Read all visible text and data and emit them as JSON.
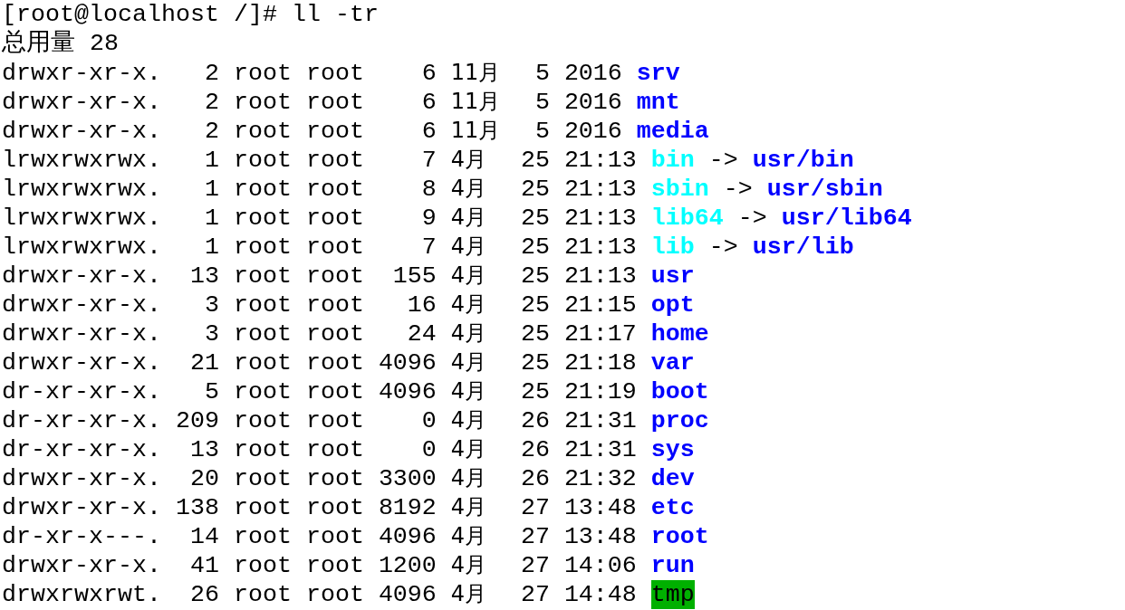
{
  "prompt": "[root@localhost /]# ll -tr",
  "total": "总用量 28",
  "rows": [
    {
      "perms": "drwxr-xr-x.",
      "links": "2",
      "owner": "root",
      "group": "root",
      "size": "6",
      "month": "11月",
      "day": "5",
      "time": "2016",
      "name": "srv",
      "kind": "dir"
    },
    {
      "perms": "drwxr-xr-x.",
      "links": "2",
      "owner": "root",
      "group": "root",
      "size": "6",
      "month": "11月",
      "day": "5",
      "time": "2016",
      "name": "mnt",
      "kind": "dir"
    },
    {
      "perms": "drwxr-xr-x.",
      "links": "2",
      "owner": "root",
      "group": "root",
      "size": "6",
      "month": "11月",
      "day": "5",
      "time": "2016",
      "name": "media",
      "kind": "dir"
    },
    {
      "perms": "lrwxrwxrwx.",
      "links": "1",
      "owner": "root",
      "group": "root",
      "size": "7",
      "month": "4月",
      "day": "25",
      "time": "21:13",
      "name": "bin",
      "kind": "link",
      "arrow": "->",
      "target": "usr/bin"
    },
    {
      "perms": "lrwxrwxrwx.",
      "links": "1",
      "owner": "root",
      "group": "root",
      "size": "8",
      "month": "4月",
      "day": "25",
      "time": "21:13",
      "name": "sbin",
      "kind": "link",
      "arrow": "->",
      "target": "usr/sbin"
    },
    {
      "perms": "lrwxrwxrwx.",
      "links": "1",
      "owner": "root",
      "group": "root",
      "size": "9",
      "month": "4月",
      "day": "25",
      "time": "21:13",
      "name": "lib64",
      "kind": "link",
      "arrow": "->",
      "target": "usr/lib64"
    },
    {
      "perms": "lrwxrwxrwx.",
      "links": "1",
      "owner": "root",
      "group": "root",
      "size": "7",
      "month": "4月",
      "day": "25",
      "time": "21:13",
      "name": "lib",
      "kind": "link",
      "arrow": "->",
      "target": "usr/lib"
    },
    {
      "perms": "drwxr-xr-x.",
      "links": "13",
      "owner": "root",
      "group": "root",
      "size": "155",
      "month": "4月",
      "day": "25",
      "time": "21:13",
      "name": "usr",
      "kind": "dir"
    },
    {
      "perms": "drwxr-xr-x.",
      "links": "3",
      "owner": "root",
      "group": "root",
      "size": "16",
      "month": "4月",
      "day": "25",
      "time": "21:15",
      "name": "opt",
      "kind": "dir"
    },
    {
      "perms": "drwxr-xr-x.",
      "links": "3",
      "owner": "root",
      "group": "root",
      "size": "24",
      "month": "4月",
      "day": "25",
      "time": "21:17",
      "name": "home",
      "kind": "dir"
    },
    {
      "perms": "drwxr-xr-x.",
      "links": "21",
      "owner": "root",
      "group": "root",
      "size": "4096",
      "month": "4月",
      "day": "25",
      "time": "21:18",
      "name": "var",
      "kind": "dir"
    },
    {
      "perms": "dr-xr-xr-x.",
      "links": "5",
      "owner": "root",
      "group": "root",
      "size": "4096",
      "month": "4月",
      "day": "25",
      "time": "21:19",
      "name": "boot",
      "kind": "dir"
    },
    {
      "perms": "dr-xr-xr-x.",
      "links": "209",
      "owner": "root",
      "group": "root",
      "size": "0",
      "month": "4月",
      "day": "26",
      "time": "21:31",
      "name": "proc",
      "kind": "dir"
    },
    {
      "perms": "dr-xr-xr-x.",
      "links": "13",
      "owner": "root",
      "group": "root",
      "size": "0",
      "month": "4月",
      "day": "26",
      "time": "21:31",
      "name": "sys",
      "kind": "dir"
    },
    {
      "perms": "drwxr-xr-x.",
      "links": "20",
      "owner": "root",
      "group": "root",
      "size": "3300",
      "month": "4月",
      "day": "26",
      "time": "21:32",
      "name": "dev",
      "kind": "dir"
    },
    {
      "perms": "drwxr-xr-x.",
      "links": "138",
      "owner": "root",
      "group": "root",
      "size": "8192",
      "month": "4月",
      "day": "27",
      "time": "13:48",
      "name": "etc",
      "kind": "dir"
    },
    {
      "perms": "dr-xr-x---.",
      "links": "14",
      "owner": "root",
      "group": "root",
      "size": "4096",
      "month": "4月",
      "day": "27",
      "time": "13:48",
      "name": "root",
      "kind": "dir"
    },
    {
      "perms": "drwxr-xr-x.",
      "links": "41",
      "owner": "root",
      "group": "root",
      "size": "1200",
      "month": "4月",
      "day": "27",
      "time": "14:06",
      "name": "run",
      "kind": "dir"
    },
    {
      "perms": "drwxrwxrwt.",
      "links": "26",
      "owner": "root",
      "group": "root",
      "size": "4096",
      "month": "4月",
      "day": "27",
      "time": "14:48",
      "name": "tmp",
      "kind": "sticky"
    }
  ]
}
